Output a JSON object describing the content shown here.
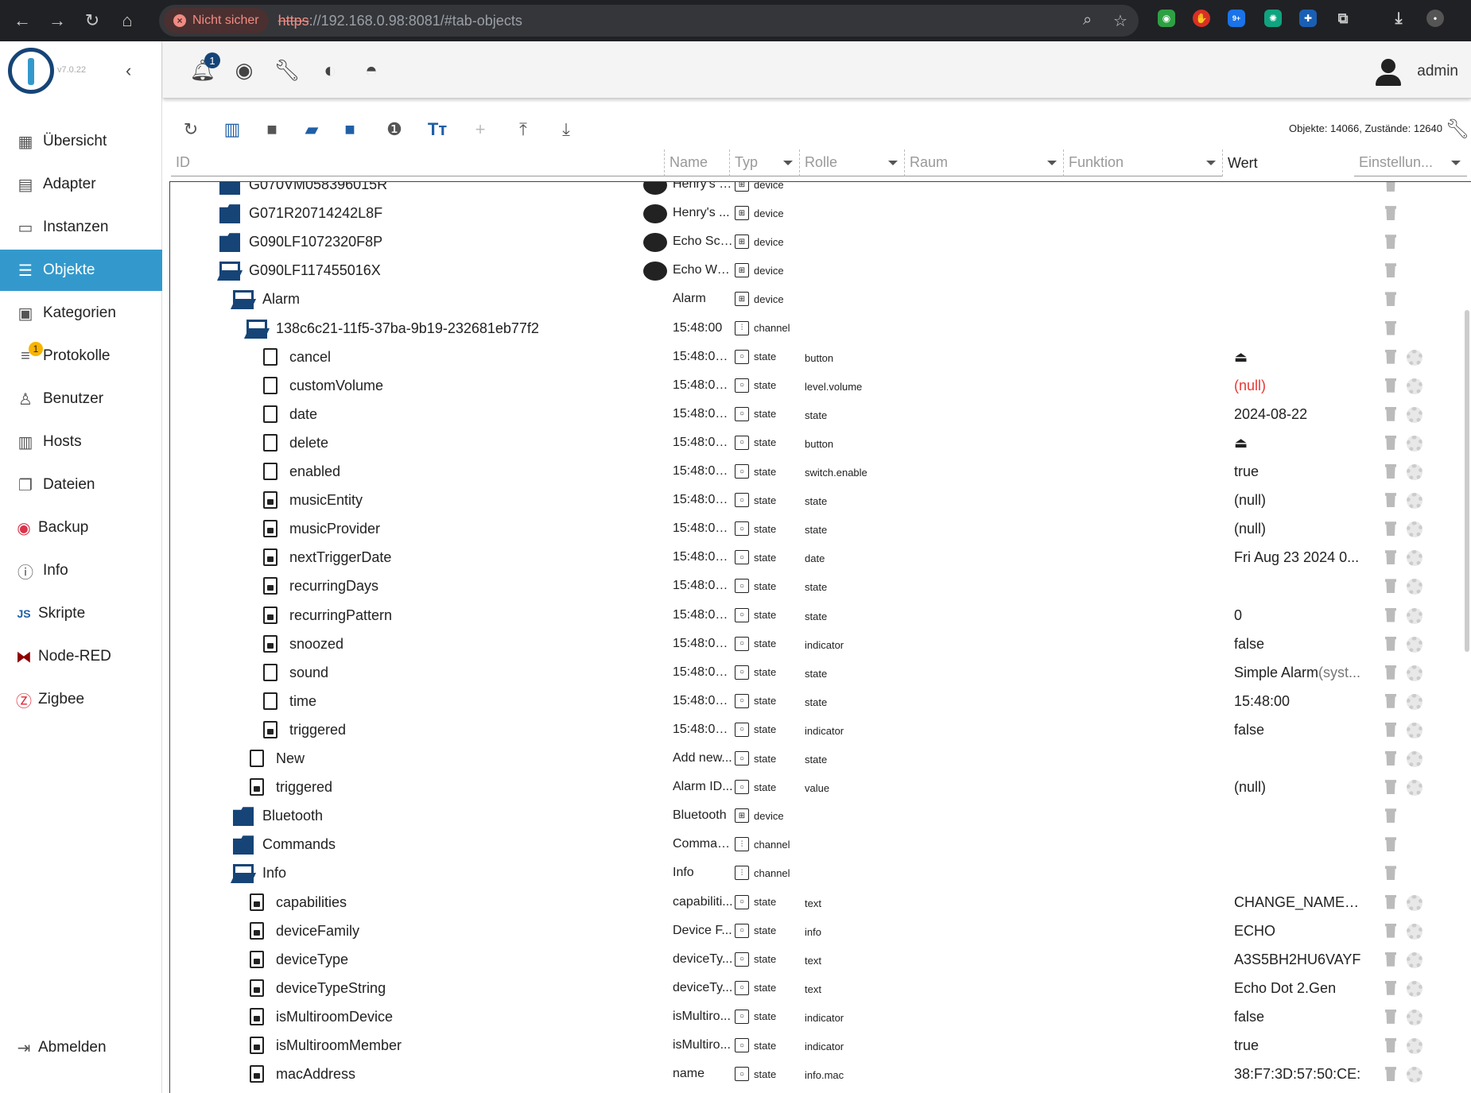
{
  "browser": {
    "security_label": "Nicht sicher",
    "url_proto": "https",
    "url_rest": "://192.168.0.98:8081/#tab-objects",
    "ext_badge": "9+"
  },
  "app": {
    "version": "v7.0.22",
    "user": "admin",
    "notifications": "1"
  },
  "nav": [
    {
      "label": "Übersicht",
      "icon": "grid-icon"
    },
    {
      "label": "Adapter",
      "icon": "store-icon"
    },
    {
      "label": "Instanzen",
      "icon": "instances-icon"
    },
    {
      "label": "Objekte",
      "icon": "list-icon"
    },
    {
      "label": "Kategorien",
      "icon": "categories-icon"
    },
    {
      "label": "Protokolle",
      "icon": "log-icon",
      "badge": "1"
    },
    {
      "label": "Benutzer",
      "icon": "user-icon"
    },
    {
      "label": "Hosts",
      "icon": "hosts-icon"
    },
    {
      "label": "Dateien",
      "icon": "files-icon"
    },
    {
      "label": "Backup",
      "icon": "backup-icon"
    },
    {
      "label": "Info",
      "icon": "info-icon"
    },
    {
      "label": "Skripte",
      "icon": "scripts-icon"
    },
    {
      "label": "Node-RED",
      "icon": "nodered-icon"
    },
    {
      "label": "Zigbee",
      "icon": "zigbee-icon"
    }
  ],
  "logout_label": "Abmelden",
  "stats": "Objekte: 14066, Zustände: 12640",
  "filters": {
    "id": "ID",
    "name": "Name",
    "type": "Typ",
    "role": "Rolle",
    "room": "Raum",
    "function": "Funktion",
    "value": "Wert",
    "settings": "Einstellun..."
  },
  "rows": [
    {
      "label": "G070VM058396015R",
      "name": "Henry's F...",
      "type": "device",
      "role": "",
      "value": "",
      "icon": "folder",
      "indent": 0
    },
    {
      "label": "G071R20714242L8F",
      "name": "Henry's ...",
      "type": "device",
      "role": "",
      "value": "",
      "icon": "folder",
      "indent": 0
    },
    {
      "label": "G090LF1072320F8P",
      "name": "Echo Sch...",
      "type": "device",
      "role": "",
      "value": "",
      "icon": "folder",
      "indent": 0
    },
    {
      "label": "G090LF117455016X",
      "name": "Echo Wo...",
      "type": "device",
      "role": "",
      "value": "",
      "icon": "folderopen",
      "indent": 0
    },
    {
      "label": "Alarm",
      "name": "Alarm",
      "type": "device",
      "role": "",
      "value": "",
      "icon": "folderopen",
      "indent": 1
    },
    {
      "label": "138c6c21-11f5-37ba-9b19-232681eb77f2",
      "name": "15:48:00",
      "type": "channel",
      "role": "",
      "value": "",
      "icon": "folderopen",
      "indent": 2
    },
    {
      "label": "cancel",
      "name": "15:48:00 ...",
      "type": "state",
      "role": "button",
      "value": "⏏",
      "icon": "file",
      "indent": 3
    },
    {
      "label": "customVolume",
      "name": "15:48:00 ...",
      "type": "state",
      "role": "level.volume",
      "value": "(null)",
      "icon": "file",
      "indent": 3,
      "null": true
    },
    {
      "label": "date",
      "name": "15:48:00 ...",
      "type": "state",
      "role": "state",
      "value": "2024-08-22",
      "icon": "file",
      "indent": 3
    },
    {
      "label": "delete",
      "name": "15:48:00 ...",
      "type": "state",
      "role": "button",
      "value": "⏏",
      "icon": "file",
      "indent": 3
    },
    {
      "label": "enabled",
      "name": "15:48:00 ...",
      "type": "state",
      "role": "switch.enable",
      "value": "true",
      "icon": "file",
      "indent": 3
    },
    {
      "label": "musicEntity",
      "name": "15:48:00 ...",
      "type": "state",
      "role": "state",
      "value": "(null)",
      "icon": "filelock",
      "indent": 3
    },
    {
      "label": "musicProvider",
      "name": "15:48:00 ...",
      "type": "state",
      "role": "state",
      "value": "(null)",
      "icon": "filelock",
      "indent": 3
    },
    {
      "label": "nextTriggerDate",
      "name": "15:48:00 ...",
      "type": "state",
      "role": "date",
      "value": "Fri Aug 23 2024 0...",
      "icon": "filelock",
      "indent": 3
    },
    {
      "label": "recurringDays",
      "name": "15:48:00 ...",
      "type": "state",
      "role": "state",
      "value": "",
      "icon": "filelock",
      "indent": 3
    },
    {
      "label": "recurringPattern",
      "name": "15:48:00 ...",
      "type": "state",
      "role": "state",
      "value": "0",
      "icon": "filelock",
      "indent": 3
    },
    {
      "label": "snoozed",
      "name": "15:48:00 ...",
      "type": "state",
      "role": "indicator",
      "value": "false",
      "icon": "filelock",
      "indent": 3
    },
    {
      "label": "sound",
      "name": "15:48:00 ...",
      "type": "state",
      "role": "state",
      "value": "Simple Alarm",
      "value_suffix": "(syst...",
      "icon": "file",
      "indent": 3
    },
    {
      "label": "time",
      "name": "15:48:00 ...",
      "type": "state",
      "role": "state",
      "value": "15:48:00",
      "icon": "file",
      "indent": 3
    },
    {
      "label": "triggered",
      "name": "15:48:00 ...",
      "type": "state",
      "role": "indicator",
      "value": "false",
      "icon": "filelock",
      "indent": 3
    },
    {
      "label": "New",
      "name": "Add new...",
      "type": "state",
      "role": "state",
      "value": "",
      "icon": "file",
      "indent": 2
    },
    {
      "label": "triggered",
      "name": "Alarm ID...",
      "type": "state",
      "role": "value",
      "value": "(null)",
      "icon": "filelock",
      "indent": 2
    },
    {
      "label": "Bluetooth",
      "name": "Bluetooth",
      "type": "device",
      "role": "",
      "value": "",
      "icon": "folder",
      "indent": 1
    },
    {
      "label": "Commands",
      "name": "Comman...",
      "type": "channel",
      "role": "",
      "value": "",
      "icon": "folder",
      "indent": 1
    },
    {
      "label": "Info",
      "name": "Info",
      "type": "channel",
      "role": "",
      "value": "",
      "icon": "folderopen",
      "indent": 1
    },
    {
      "label": "capabilities",
      "name": "capabiliti...",
      "type": "state",
      "role": "text",
      "value": "CHANGE_NAME,A...",
      "icon": "filelock",
      "indent": 2
    },
    {
      "label": "deviceFamily",
      "name": "Device F...",
      "type": "state",
      "role": "info",
      "value": "ECHO",
      "icon": "filelock",
      "indent": 2
    },
    {
      "label": "deviceType",
      "name": "deviceTy...",
      "type": "state",
      "role": "text",
      "value": "A3S5BH2HU6VAYF",
      "icon": "filelock",
      "indent": 2
    },
    {
      "label": "deviceTypeString",
      "name": "deviceTy...",
      "type": "state",
      "role": "text",
      "value": "Echo Dot 2.Gen",
      "icon": "filelock",
      "indent": 2
    },
    {
      "label": "isMultiroomDevice",
      "name": "isMultiro...",
      "type": "state",
      "role": "indicator",
      "value": "false",
      "icon": "filelock",
      "indent": 2
    },
    {
      "label": "isMultiroomMember",
      "name": "isMultiro...",
      "type": "state",
      "role": "indicator",
      "value": "true",
      "icon": "filelock",
      "indent": 2
    },
    {
      "label": "macAddress",
      "name": "name",
      "type": "state",
      "role": "info.mac",
      "value": "38:F7:3D:57:50:CE:",
      "icon": "filelock",
      "indent": 2
    }
  ]
}
